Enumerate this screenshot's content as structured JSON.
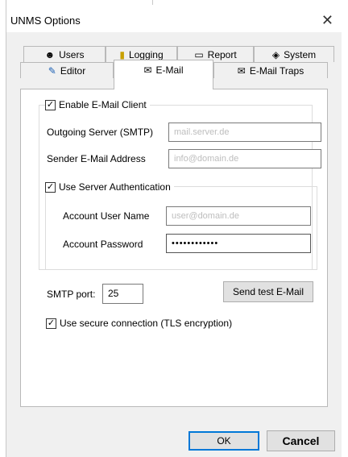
{
  "window": {
    "title": "UNMS Options",
    "close_glyph": "✕"
  },
  "tabs_row1": [
    {
      "label": "Users",
      "icon": "users-icon",
      "glyph": "☻"
    },
    {
      "label": "Logging",
      "icon": "logging-icon",
      "glyph": "▮"
    },
    {
      "label": "Report",
      "icon": "report-icon",
      "glyph": "▭"
    },
    {
      "label": "System",
      "icon": "system-icon",
      "glyph": "◈"
    }
  ],
  "tabs_row2": [
    {
      "label": "Editor",
      "icon": "editor-icon",
      "glyph": "✎"
    },
    {
      "label": "E-Mail",
      "icon": "email-icon",
      "glyph": "✉",
      "active": true
    },
    {
      "label": "E-Mail Traps",
      "icon": "email-traps-icon",
      "glyph": "✉"
    }
  ],
  "email": {
    "enable_client": {
      "label": "Enable E-Mail Client",
      "checked": true
    },
    "outgoing_server": {
      "label": "Outgoing Server (SMTP)",
      "value": "mail.server.de"
    },
    "sender_address": {
      "label": "Sender E-Mail Address",
      "value": "info@domain.de"
    },
    "use_auth": {
      "label": "Use Server Authentication",
      "checked": true
    },
    "account_user": {
      "label": "Account User Name",
      "value": "user@domain.de"
    },
    "account_password": {
      "label": "Account Password",
      "value": "••••••••••••"
    },
    "smtp_port": {
      "label": "SMTP port:",
      "value": "25"
    },
    "send_test_button": "Send test E-Mail",
    "secure_connection": {
      "label": "Use secure connection (TLS encryption)",
      "checked": true
    }
  },
  "footer": {
    "ok_label": "OK",
    "cancel_label": "Cancel"
  }
}
